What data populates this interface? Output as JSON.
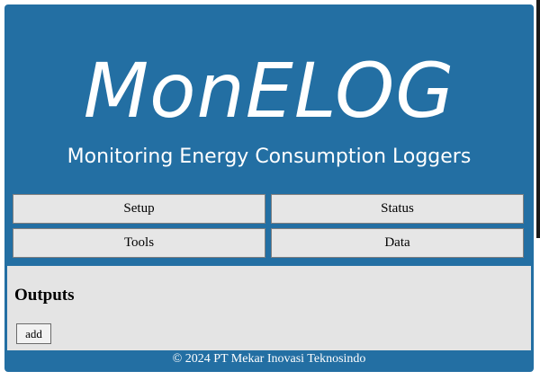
{
  "header": {
    "logo_text": "MonELOG",
    "subtitle": "Monitoring Energy Consumption Loggers"
  },
  "nav": {
    "buttons": [
      {
        "label": "Setup"
      },
      {
        "label": "Status"
      },
      {
        "label": "Tools"
      },
      {
        "label": "Data"
      }
    ]
  },
  "outputs": {
    "title": "Outputs",
    "add_label": "add"
  },
  "footer": {
    "text": "© 2024 PT Mekar Inovasi Teknosindo"
  },
  "colors": {
    "app_background": "#236fa3",
    "button_background": "#e6e6e6",
    "panel_background": "#e4e4e4",
    "text_on_brand": "#ffffff"
  }
}
